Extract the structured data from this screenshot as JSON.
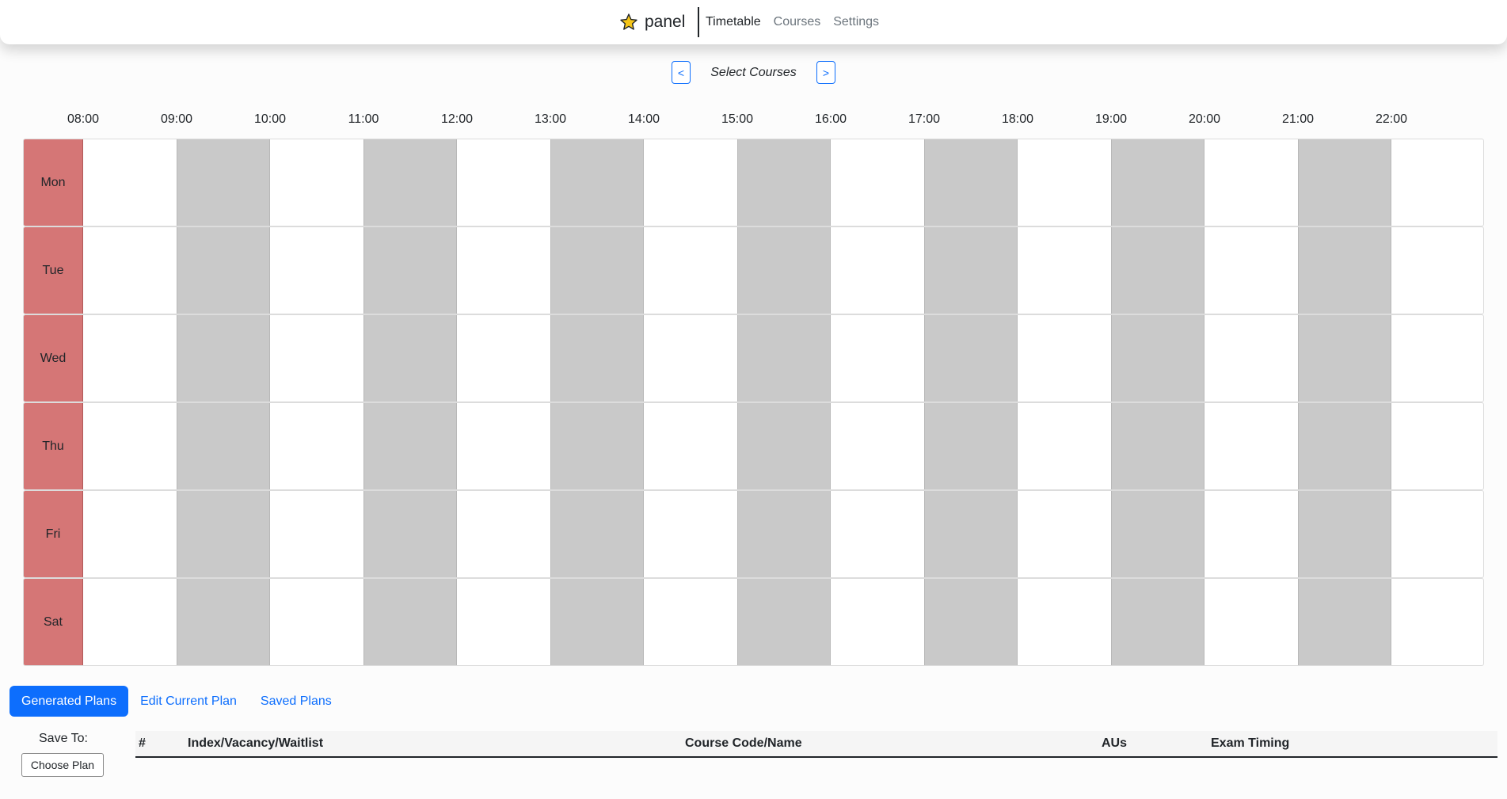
{
  "navbar": {
    "brand": "panel",
    "links": [
      "Timetable",
      "Courses",
      "Settings"
    ]
  },
  "selector": {
    "prev": "<",
    "label": "Select Courses",
    "next": ">"
  },
  "timetable": {
    "times": [
      "08:00",
      "09:00",
      "10:00",
      "11:00",
      "12:00",
      "13:00",
      "14:00",
      "15:00",
      "16:00",
      "17:00",
      "18:00",
      "19:00",
      "20:00",
      "21:00",
      "22:00"
    ],
    "days": [
      "Mon",
      "Tue",
      "Wed",
      "Thu",
      "Fri",
      "Sat"
    ]
  },
  "tabs": [
    "Generated Plans",
    "Edit Current Plan",
    "Saved Plans"
  ],
  "save": {
    "label": "Save To:",
    "button": "Choose Plan"
  },
  "table": {
    "headers": [
      "#",
      "Index/Vacancy/Waitlist",
      "Course Code/Name",
      "AUs",
      "Exam Timing"
    ]
  },
  "colors": {
    "accent": "#0d6efd",
    "day_label": "#d57676",
    "shade": "#c9c9c9"
  }
}
